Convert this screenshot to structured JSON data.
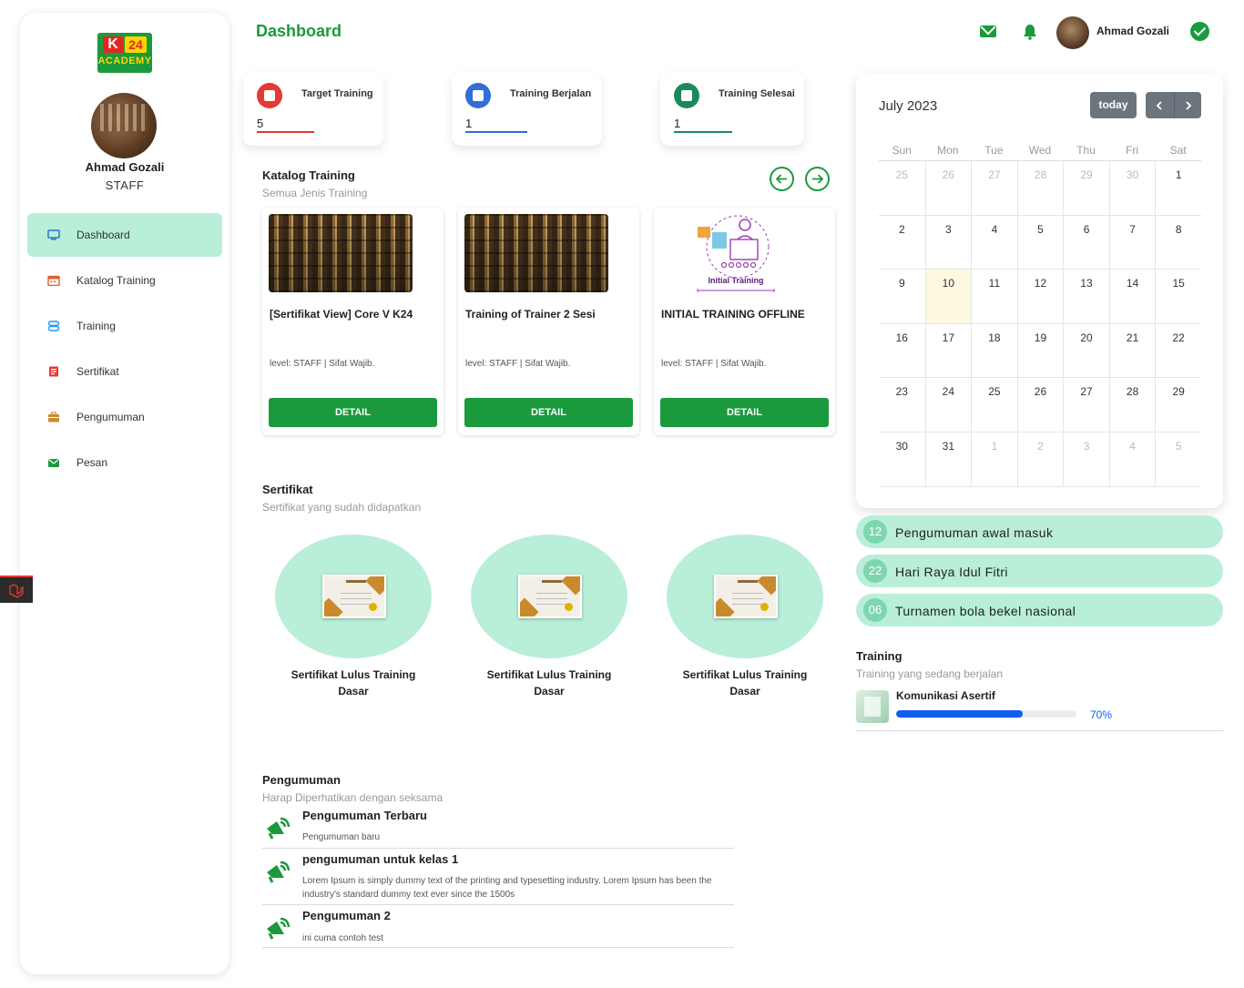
{
  "sidebar": {
    "logo": {
      "k": "K",
      "num": "24",
      "academy": "ACADEMY"
    },
    "user": {
      "name": "Ahmad Gozali",
      "role": "STAFF"
    },
    "items": [
      {
        "label": "Dashboard",
        "icon": "monitor-icon",
        "color": "#2f6fd6"
      },
      {
        "label": "Katalog Training",
        "icon": "calendar-icon",
        "color": "#e65a2e"
      },
      {
        "label": "Training",
        "icon": "training-icon",
        "color": "#2196f3"
      },
      {
        "label": "Sertifikat",
        "icon": "certificate-icon",
        "color": "#e53935"
      },
      {
        "label": "Pengumuman",
        "icon": "briefcase-icon",
        "color": "#c98a2e"
      },
      {
        "label": "Pesan",
        "icon": "envelope-icon",
        "color": "#1a9a3c"
      }
    ]
  },
  "header": {
    "title": "Dashboard",
    "user_name": "Ahmad Gozali"
  },
  "stats": [
    {
      "title": "Target Training",
      "value": "5",
      "color": "#e53935"
    },
    {
      "title": "Training Berjalan",
      "value": "1",
      "color": "#2f6fd6"
    },
    {
      "title": "Training Selesai",
      "value": "1",
      "color": "#1a8a5a"
    }
  ],
  "katalog": {
    "title": "Katalog Training",
    "subtitle": "Semua Jenis Training",
    "cards": [
      {
        "name": "[Sertifikat View] Core V K24",
        "meta": "level: STAFF | Sifat Wajib.",
        "button": "DETAIL"
      },
      {
        "name": "Training of Trainer 2 Sesi",
        "meta": "level: STAFF | Sifat Wajib.",
        "button": "DETAIL"
      },
      {
        "name": "INITIAL TRAINING OFFLINE",
        "meta": "level: STAFF | Sifat Wajib.",
        "button": "DETAIL",
        "illustration_label": "Initial Training"
      }
    ]
  },
  "sertifikat": {
    "title": "Sertifikat",
    "subtitle": "Sertifikat yang sudah didapatkan",
    "items": [
      {
        "name": "Sertifikat Lulus Training Dasar"
      },
      {
        "name": "Sertifikat Lulus Training Dasar"
      },
      {
        "name": "Sertifikat Lulus Training Dasar"
      }
    ]
  },
  "pengumuman": {
    "title": "Pengumuman",
    "subtitle": "Harap Diperhatikan dengan seksama",
    "items": [
      {
        "title": "Pengumuman Terbaru",
        "desc": "Pengumuman baru"
      },
      {
        "title": "pengumuman untuk kelas 1",
        "desc": "Lorem Ipsum is simply dummy text of the printing and typesetting industry. Lorem Ipsum has been the industry's standard dummy text ever since the 1500s"
      },
      {
        "title": "Pengumuman 2",
        "desc": "ini cuma contoh test"
      }
    ]
  },
  "calendar": {
    "title": "July 2023",
    "today_label": "today",
    "weekdays": [
      "Sun",
      "Mon",
      "Tue",
      "Wed",
      "Thu",
      "Fri",
      "Sat"
    ],
    "weeks": [
      [
        "25",
        "26",
        "27",
        "28",
        "29",
        "30",
        "1"
      ],
      [
        "2",
        "3",
        "4",
        "5",
        "6",
        "7",
        "8"
      ],
      [
        "9",
        "10",
        "11",
        "12",
        "13",
        "14",
        "15"
      ],
      [
        "16",
        "17",
        "18",
        "19",
        "20",
        "21",
        "22"
      ],
      [
        "23",
        "24",
        "25",
        "26",
        "27",
        "28",
        "29"
      ],
      [
        "30",
        "31",
        "1",
        "2",
        "3",
        "4",
        "5"
      ]
    ],
    "today": "10"
  },
  "events": [
    {
      "day": "12",
      "label": "Pengumuman awal masuk"
    },
    {
      "day": "22",
      "label": "Hari Raya Idul Fitri"
    },
    {
      "day": "06",
      "label": "Turnamen bola bekel nasional"
    }
  ],
  "training": {
    "title": "Training",
    "subtitle": "Training yang sedang berjalan",
    "item": {
      "name": "Komunikasi Asertif",
      "progress_label": "70%",
      "progress": 0.7
    }
  }
}
